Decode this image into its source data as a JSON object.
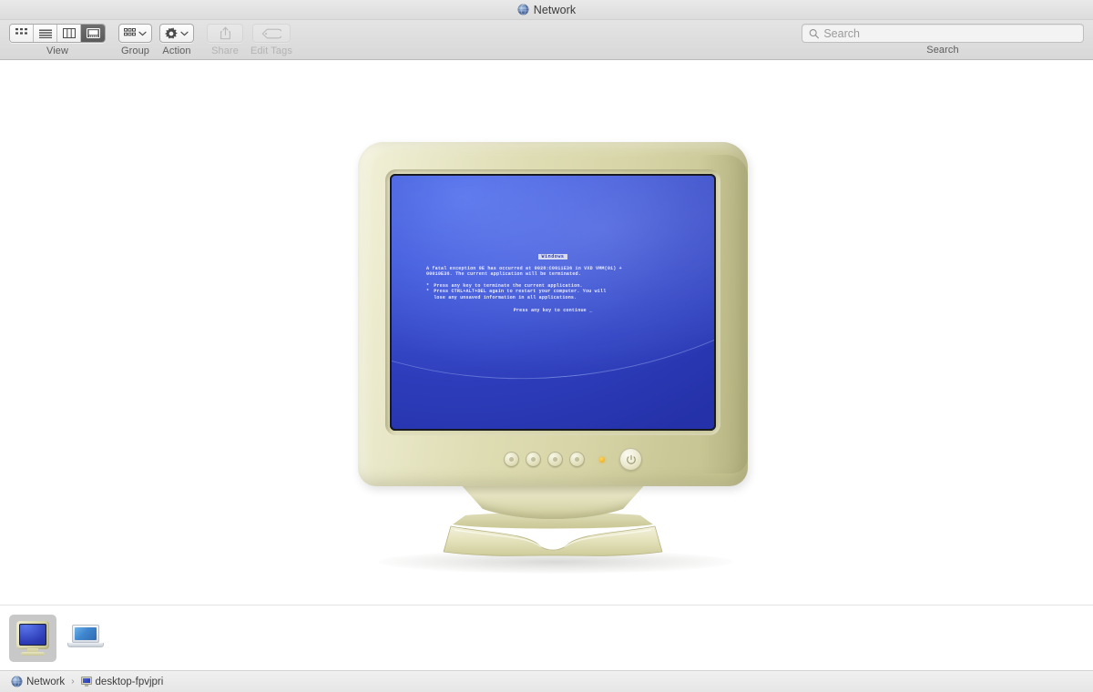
{
  "window": {
    "title": "Network",
    "title_icon": "globe-network-icon"
  },
  "toolbar": {
    "view": {
      "caption": "View",
      "options": [
        {
          "name": "icon-view",
          "icon": "grid-icon",
          "active": false
        },
        {
          "name": "list-view",
          "icon": "list-icon",
          "active": false
        },
        {
          "name": "column-view",
          "icon": "columns-icon",
          "active": false
        },
        {
          "name": "gallery-view",
          "icon": "gallery-icon",
          "active": true
        }
      ]
    },
    "group": {
      "caption": "Group",
      "icon": "grid-icon",
      "chevron": "chevron-down-icon",
      "disabled": false
    },
    "action": {
      "caption": "Action",
      "icon": "gear-icon",
      "chevron": "chevron-down-icon",
      "disabled": false
    },
    "share": {
      "caption": "Share",
      "icon": "share-upload-icon",
      "disabled": true
    },
    "edit_tags": {
      "caption": "Edit Tags",
      "icon": "tag-icon",
      "disabled": true
    }
  },
  "search": {
    "caption": "Search",
    "placeholder": "Search",
    "value": "",
    "icon": "search-icon"
  },
  "preview": {
    "device": "crt-monitor",
    "screen": {
      "os_label": "Windows",
      "paragraph_line1": "A fatal exception 0E has occurred at 0028:C0011E36 in VXD VMM(01) +",
      "paragraph_line2": "00010E36. The current application will be terminated.",
      "bullets": [
        "Press any key to terminate the current application.",
        "Press CTRL+ALT+DEL again to restart your computer. You will"
      ],
      "bullet2_cont": "lose any unsaved information in all applications.",
      "continue_line": "Press any key to continue _",
      "bullet_char": "*",
      "bg_color": "#3445c4",
      "text_color": "#e9ecff"
    },
    "controls": {
      "knobs": 4,
      "led": {
        "name": "power-led",
        "color": "#e8a516"
      },
      "power_button": {
        "name": "power-button",
        "icon": "power-icon"
      }
    }
  },
  "shelf": {
    "items": [
      {
        "name": "crt-monitor-item",
        "icon": "crt-monitor-icon",
        "selected": true
      },
      {
        "name": "laptop-item",
        "icon": "laptop-icon",
        "selected": false
      }
    ]
  },
  "pathbar": {
    "crumbs": [
      {
        "label": "Network",
        "icon": "globe-network-icon"
      },
      {
        "label": "desktop-fpvjpri",
        "icon": "crt-monitor-icon"
      }
    ],
    "separator": "›"
  },
  "colors": {
    "toolbar_bg": "#dcdcdc",
    "bezel_beige": "#dedcb2",
    "screen_blue": "#3445c4",
    "selection_gray": "#c8c8c8"
  }
}
